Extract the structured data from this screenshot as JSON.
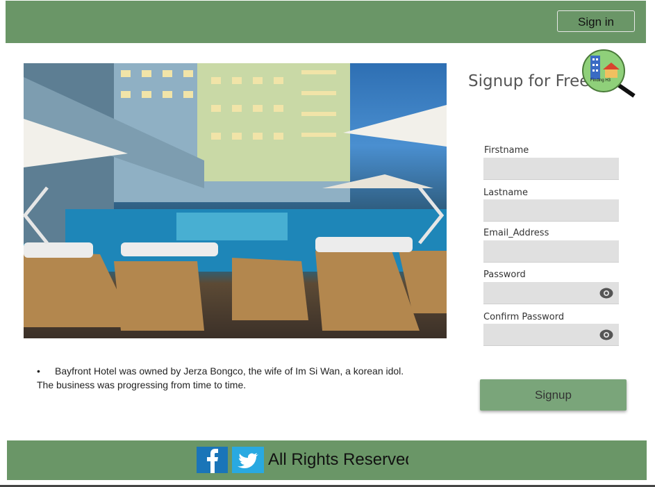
{
  "header": {
    "signin_label": "Sign in"
  },
  "carousel": {
    "prev_icon": "chevron-left-icon",
    "next_icon": "chevron-right-icon"
  },
  "description": {
    "line1": "Bayfront Hotel was owned by Jerza Bongco, the wife of Im Si Wan, a korean idol.",
    "line2": "The business was progressing from time to time."
  },
  "signup": {
    "title": "Signup for Free",
    "logo_text": "Finding H3",
    "fields": [
      {
        "label": "Firstname",
        "value": ""
      },
      {
        "label": "Lastname",
        "value": ""
      },
      {
        "label": "Email_Address",
        "value": ""
      },
      {
        "label": "Password",
        "value": ""
      },
      {
        "label": "Confirm Password",
        "value": ""
      }
    ],
    "submit_label": "Signup"
  },
  "footer": {
    "rights_text": "All Rights Reserved",
    "facebook_icon": "facebook-icon",
    "twitter_icon": "twitter-icon"
  },
  "colors": {
    "header_bg": "#6a9667",
    "button_bg": "#7aa57a",
    "field_bg": "#e0e0e0"
  }
}
